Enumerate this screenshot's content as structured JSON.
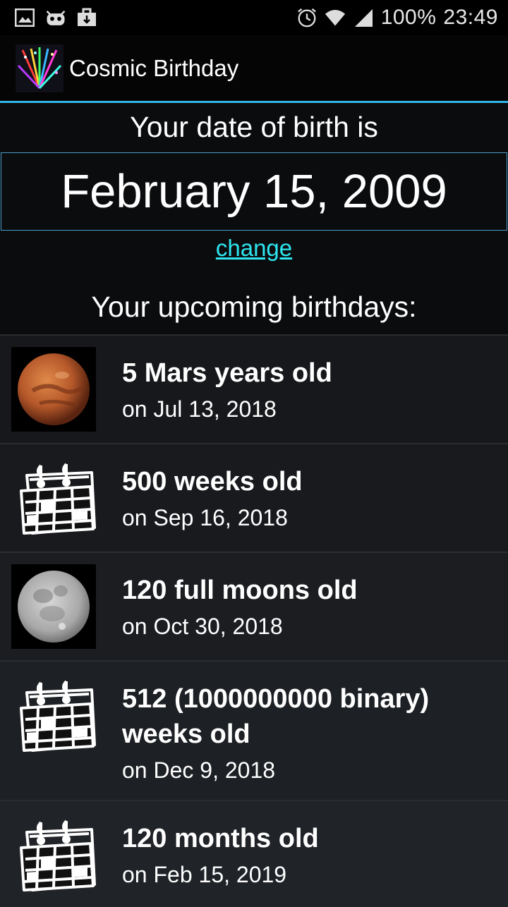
{
  "status_bar": {
    "battery": "100%",
    "time": "23:49",
    "left_icons": [
      "image-icon",
      "android-icon",
      "briefcase-icon"
    ],
    "right_icons": [
      "alarm-icon",
      "wifi-icon",
      "signal-icon"
    ]
  },
  "app_bar": {
    "title": "Cosmic Birthday",
    "icon": "app-logo-icon",
    "accent_color": "#33b5e5"
  },
  "birth": {
    "label": "Your date of birth is",
    "date": "February 15, 2009",
    "change_link": "change",
    "link_color": "#2ee6f0"
  },
  "upcoming": {
    "label": "Your upcoming birthdays:",
    "items": [
      {
        "title": "5 Mars years old",
        "date": "on Jul 13, 2018",
        "image": "mars-image",
        "bg": "#16181b"
      },
      {
        "title": "500 weeks old",
        "date": "on Sep 16, 2018",
        "image": "calendar-icon",
        "bg": "#181a1e"
      },
      {
        "title": "120 full moons old",
        "date": "on Oct 30, 2018",
        "image": "moon-image",
        "bg": "#1b1d21"
      },
      {
        "title": "512 (1000000000 binary) weeks old",
        "date": "on Dec 9, 2018",
        "image": "calendar-icon",
        "bg": "#1d2024"
      },
      {
        "title": "120 months old",
        "date": "on Feb 15, 2019",
        "image": "calendar-icon",
        "bg": "#202328"
      }
    ]
  }
}
